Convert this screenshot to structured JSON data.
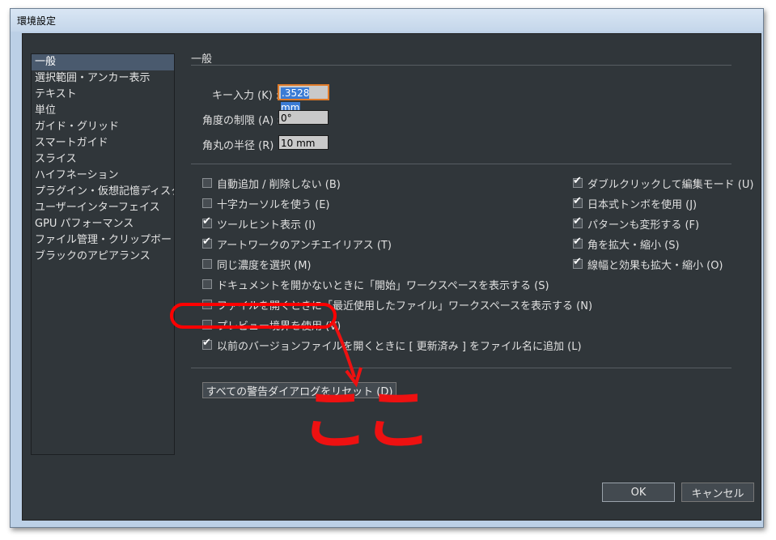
{
  "window": {
    "title": "環境設定"
  },
  "sidebar": {
    "items": [
      {
        "label": "一般",
        "selected": true
      },
      {
        "label": "選択範囲・アンカー表示"
      },
      {
        "label": "テキスト"
      },
      {
        "label": "単位"
      },
      {
        "label": "ガイド・グリッド"
      },
      {
        "label": "スマートガイド"
      },
      {
        "label": "スライス"
      },
      {
        "label": "ハイフネーション"
      },
      {
        "label": "プラグイン・仮想記憶ディスク"
      },
      {
        "label": "ユーザーインターフェイス"
      },
      {
        "label": "GPU パフォーマンス"
      },
      {
        "label": "ファイル管理・クリップボード"
      },
      {
        "label": "ブラックのアピアランス"
      }
    ]
  },
  "general": {
    "section_title": "一般",
    "fields": {
      "key_input": {
        "label": "キー入力 (K) :",
        "value": ".3528 mm"
      },
      "constrain_angle": {
        "label": "角度の制限 (A) :",
        "value": "0°"
      },
      "corner_radius": {
        "label": "角丸の半径 (R) :",
        "value": "10 mm"
      }
    },
    "checks_left": [
      {
        "label": "自動追加 / 削除しない (B)",
        "checked": false
      },
      {
        "label": "十字カーソルを使う (E)",
        "checked": false
      },
      {
        "label": "ツールヒント表示 (I)",
        "checked": true
      },
      {
        "label": "アートワークのアンチエイリアス (T)",
        "checked": true
      },
      {
        "label": "同じ濃度を選択 (M)",
        "checked": false
      },
      {
        "label": "ドキュメントを開かないときに「開始」ワークスペースを表示する (S)",
        "checked": false
      },
      {
        "label": "ファイルを開くときに「最近使用したファイル」ワークスペースを表示する (N)",
        "checked": false
      },
      {
        "label": "プレビュー境界を使用 (V)",
        "checked": false
      },
      {
        "label": "以前のバージョンファイルを開くときに [ 更新済み ] をファイル名に追加 (L)",
        "checked": true
      }
    ],
    "checks_right": [
      {
        "label": "ダブルクリックして編集モード (U)",
        "checked": true
      },
      {
        "label": "日本式トンボを使用 (J)",
        "checked": true
      },
      {
        "label": "パターンも変形する (F)",
        "checked": true
      },
      {
        "label": "角を拡大・縮小 (S)",
        "checked": true
      },
      {
        "label": "線幅と効果も拡大・縮小 (O)",
        "checked": true
      }
    ],
    "reset_button": "すべての警告ダイアログをリセット (D)"
  },
  "buttons": {
    "ok": "OK",
    "cancel": "キャンセル"
  },
  "annotation": {
    "text": "ここ",
    "color": "#ee1111"
  }
}
